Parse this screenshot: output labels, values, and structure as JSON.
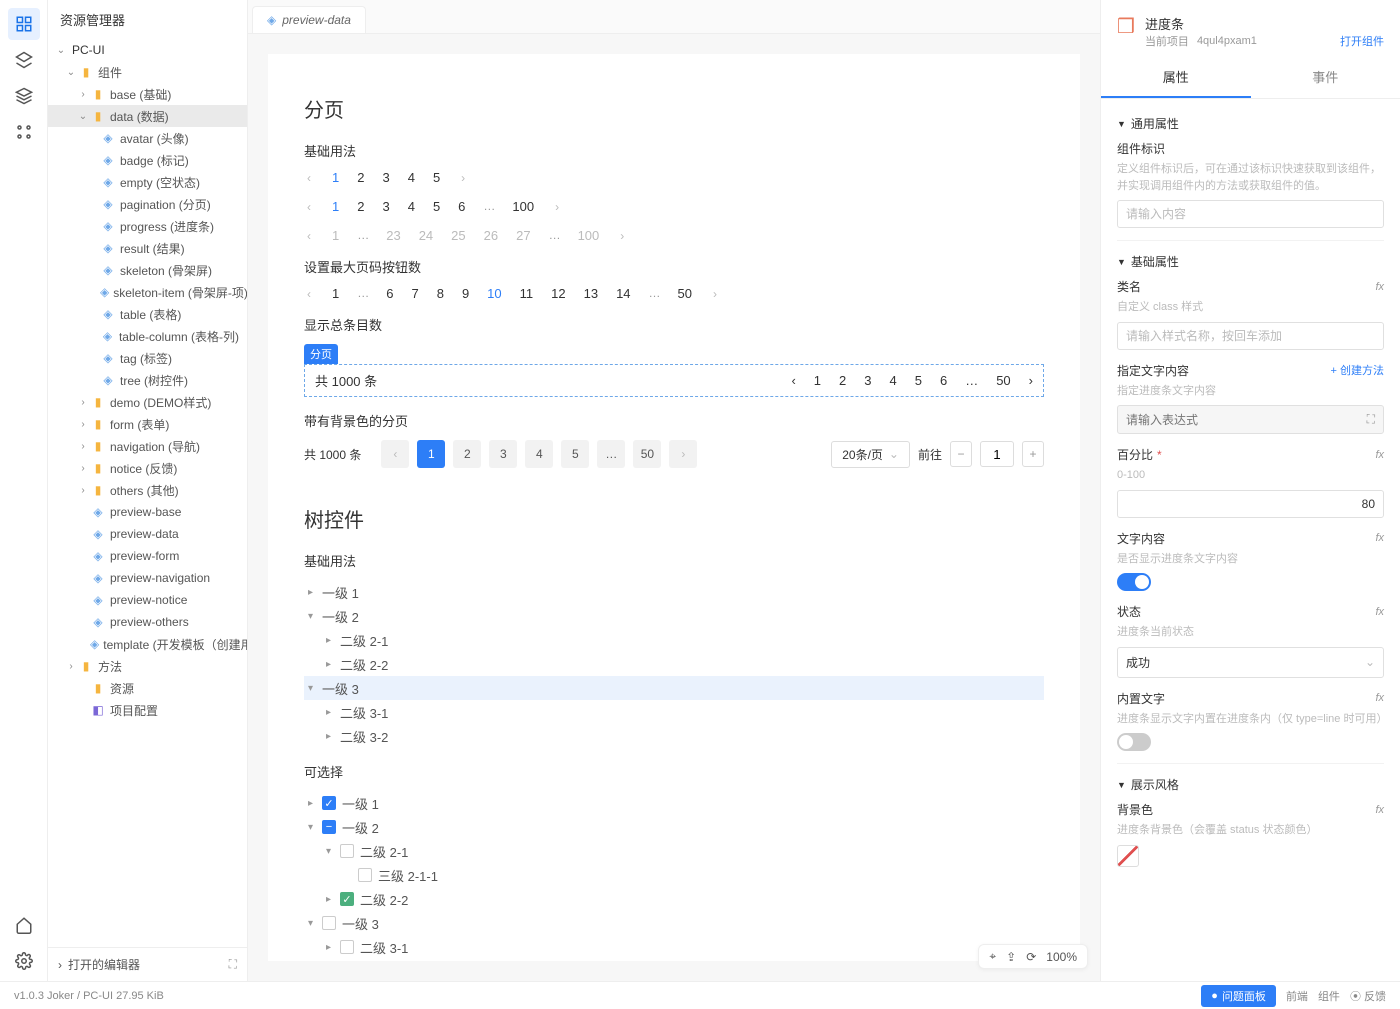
{
  "sidebar": {
    "title": "资源管理器",
    "root": "PC-UI",
    "components": "组件",
    "base": "base (基础)",
    "data": "data (数据)",
    "data_items": [
      "avatar (头像)",
      "badge (标记)",
      "empty (空状态)",
      "pagination (分页)",
      "progress (进度条)",
      "result (结果)",
      "skeleton (骨架屏)",
      "skeleton-item (骨架屏-项)",
      "table (表格)",
      "table-column (表格-列)",
      "tag (标签)",
      "tree (树控件)"
    ],
    "after": [
      "demo (DEMO样式)",
      "form (表单)",
      "navigation (导航)",
      "notice (反馈)",
      "others (其他)"
    ],
    "previews": [
      "preview-base",
      "preview-data",
      "preview-form",
      "preview-navigation",
      "preview-notice",
      "preview-others",
      "template (开发模板（创建用）)"
    ],
    "methods": "方法",
    "resources": "资源",
    "config": "项目配置",
    "open_editor": "打开的编辑器"
  },
  "tab": {
    "label": "preview-data"
  },
  "page": {
    "h_pagination": "分页",
    "s_basic": "基础用法",
    "pager1": [
      "1",
      "2",
      "3",
      "4",
      "5"
    ],
    "pager2": {
      "items": [
        "1",
        "2",
        "3",
        "4",
        "5",
        "6",
        "…",
        "100"
      ],
      "active": "1"
    },
    "pager3": [
      "1",
      "…",
      "23",
      "24",
      "25",
      "26",
      "27",
      "…",
      "100"
    ],
    "s_max": "设置最大页码按钮数",
    "pager4": {
      "items": [
        "1",
        "…",
        "6",
        "7",
        "8",
        "9",
        "10",
        "11",
        "12",
        "13",
        "14",
        "…",
        "50"
      ],
      "active": "10"
    },
    "s_total": "显示总条目数",
    "chip": "分页",
    "total_text": "共 1000 条",
    "pager5": [
      "1",
      "2",
      "3",
      "4",
      "5",
      "6",
      "…",
      "50"
    ],
    "s_bg": "带有背景色的分页",
    "bg_items": [
      "1",
      "2",
      "3",
      "4",
      "5",
      "…",
      "50"
    ],
    "page_size": "20条/页",
    "goto": "前往",
    "goto_val": "1",
    "h_tree": "树控件",
    "tree_basic": "基础用法",
    "tree1": [
      "一级 1",
      "一级 2",
      "二级 2-1",
      "二级 2-2",
      "一级 3",
      "二级 3-1",
      "二级 3-2"
    ],
    "selectable": "可选择",
    "tree2": [
      "一级 1",
      "一级 2",
      "二级 2-1",
      "三级 2-1-1",
      "二级 2-2",
      "一级 3",
      "二级 3-1",
      "二级 3-2"
    ]
  },
  "zoom": "100%",
  "right": {
    "title": "进度条",
    "proj_label": "当前项目",
    "proj": "4qul4pxam1",
    "open": "打开组件",
    "tab_attr": "属性",
    "tab_event": "事件",
    "sect_general": "通用属性",
    "id_label": "组件标识",
    "id_hint": "定义组件标识后，可在通过该标识快速获取到该组件，并实现调用组件内的方法或获取组件的值。",
    "id_ph": "请输入内容",
    "sect_basic": "基础属性",
    "class_label": "类名",
    "class_hint": "自定义 class 样式",
    "class_ph": "请输入样式名称，按回车添加",
    "text_label": "指定文字内容",
    "create_method": "创建方法",
    "text_hint": "指定进度条文字内容",
    "expr_ph": "请输入表达式",
    "percent_label": "百分比",
    "percent_hint": "0-100",
    "percent_val": "80",
    "textcontent_label": "文字内容",
    "textcontent_hint": "是否显示进度条文字内容",
    "status_label": "状态",
    "status_hint": "进度条当前状态",
    "status_val": "成功",
    "inner_label": "内置文字",
    "inner_hint": "进度条显示文字内置在进度条内（仅 type=line 时可用）",
    "sect_style": "展示风格",
    "bg_label": "背景色",
    "bg_hint": "进度条背景色（会覆盖 status 状态颜色）",
    "fx": "fx"
  },
  "status": {
    "left": "v1.0.3   Joker / PC-UI   27.95 KiB",
    "issue": "问题面板",
    "front": "前端",
    "comp": "组件",
    "feedback": "反馈"
  }
}
